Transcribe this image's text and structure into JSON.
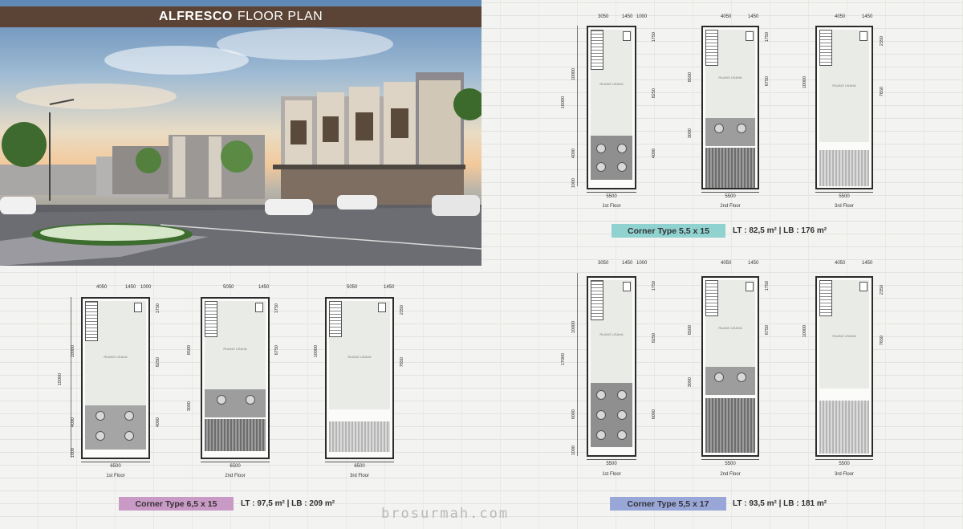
{
  "banner": {
    "title_bold": "ALFRESCO",
    "title_rest": "FLOOR PLAN"
  },
  "colors": {
    "banner_bg": "#5b4436",
    "type_a_bg": "#8fd2d0",
    "type_b_bg": "#c99ac6",
    "type_c_bg": "#98a6d8"
  },
  "floor_labels": [
    "1st Floor",
    "2nd Floor",
    "3rd Floor"
  ],
  "room_labels": {
    "shop": "RUANG USAHA"
  },
  "types": {
    "a": {
      "name": "Corner Type 5,5 x 15",
      "area": "LT : 82,5 m²  |  LB : 176 m²",
      "f1": {
        "top_dims": [
          "3050",
          "1450",
          "1000"
        ],
        "left_dims": [
          "16000",
          "10000",
          "4000",
          "1000"
        ],
        "right_dims": [
          "1750",
          "8250",
          "4000"
        ],
        "width": "5500"
      },
      "f2": {
        "top_dims": [
          "4050",
          "1450"
        ],
        "left_dims": [
          "8500",
          "3000"
        ],
        "right_dims": [
          "1750",
          "6750"
        ],
        "width": "5500"
      },
      "f3": {
        "top_dims": [
          "4050",
          "1450"
        ],
        "left_dims": [
          "10000"
        ],
        "right_dims": [
          "2350",
          "7650"
        ],
        "width": "5500"
      }
    },
    "b": {
      "name": "Corner Type 6,5 x 15",
      "area": "LT : 97,5 m²  |  LB : 209 m²",
      "f1": {
        "top_dims": [
          "4050",
          "1450",
          "1000"
        ],
        "left_dims": [
          "15000",
          "10000",
          "4000",
          "1000"
        ],
        "right_dims": [
          "1750",
          "8250",
          "4000"
        ],
        "width": "6500"
      },
      "f2": {
        "top_dims": [
          "5050",
          "1450"
        ],
        "left_dims": [
          "8500",
          "3000"
        ],
        "right_dims": [
          "1750",
          "6750"
        ],
        "width": "6500"
      },
      "f3": {
        "top_dims": [
          "5050",
          "1450"
        ],
        "left_dims": [
          "10000"
        ],
        "right_dims": [
          "2350",
          "7650"
        ],
        "width": "6500"
      }
    },
    "c": {
      "name": "Corner Type 5,5 x 17",
      "area": "LT : 93,5 m²  |  LB : 181 m²",
      "f1": {
        "top_dims": [
          "3050",
          "1450",
          "1000"
        ],
        "left_dims": [
          "17000",
          "10000",
          "6000",
          "1000"
        ],
        "right_dims": [
          "1750",
          "8250",
          "6000"
        ],
        "width": "5500"
      },
      "f2": {
        "top_dims": [
          "4050",
          "1450"
        ],
        "left_dims": [
          "8500",
          "3000"
        ],
        "right_dims": [
          "1750",
          "6750"
        ],
        "width": "5500"
      },
      "f3": {
        "top_dims": [
          "4050",
          "1450"
        ],
        "left_dims": [
          "10000"
        ],
        "right_dims": [
          "2350",
          "7650"
        ],
        "width": "5500"
      }
    }
  },
  "watermark": "brosurmah.com"
}
